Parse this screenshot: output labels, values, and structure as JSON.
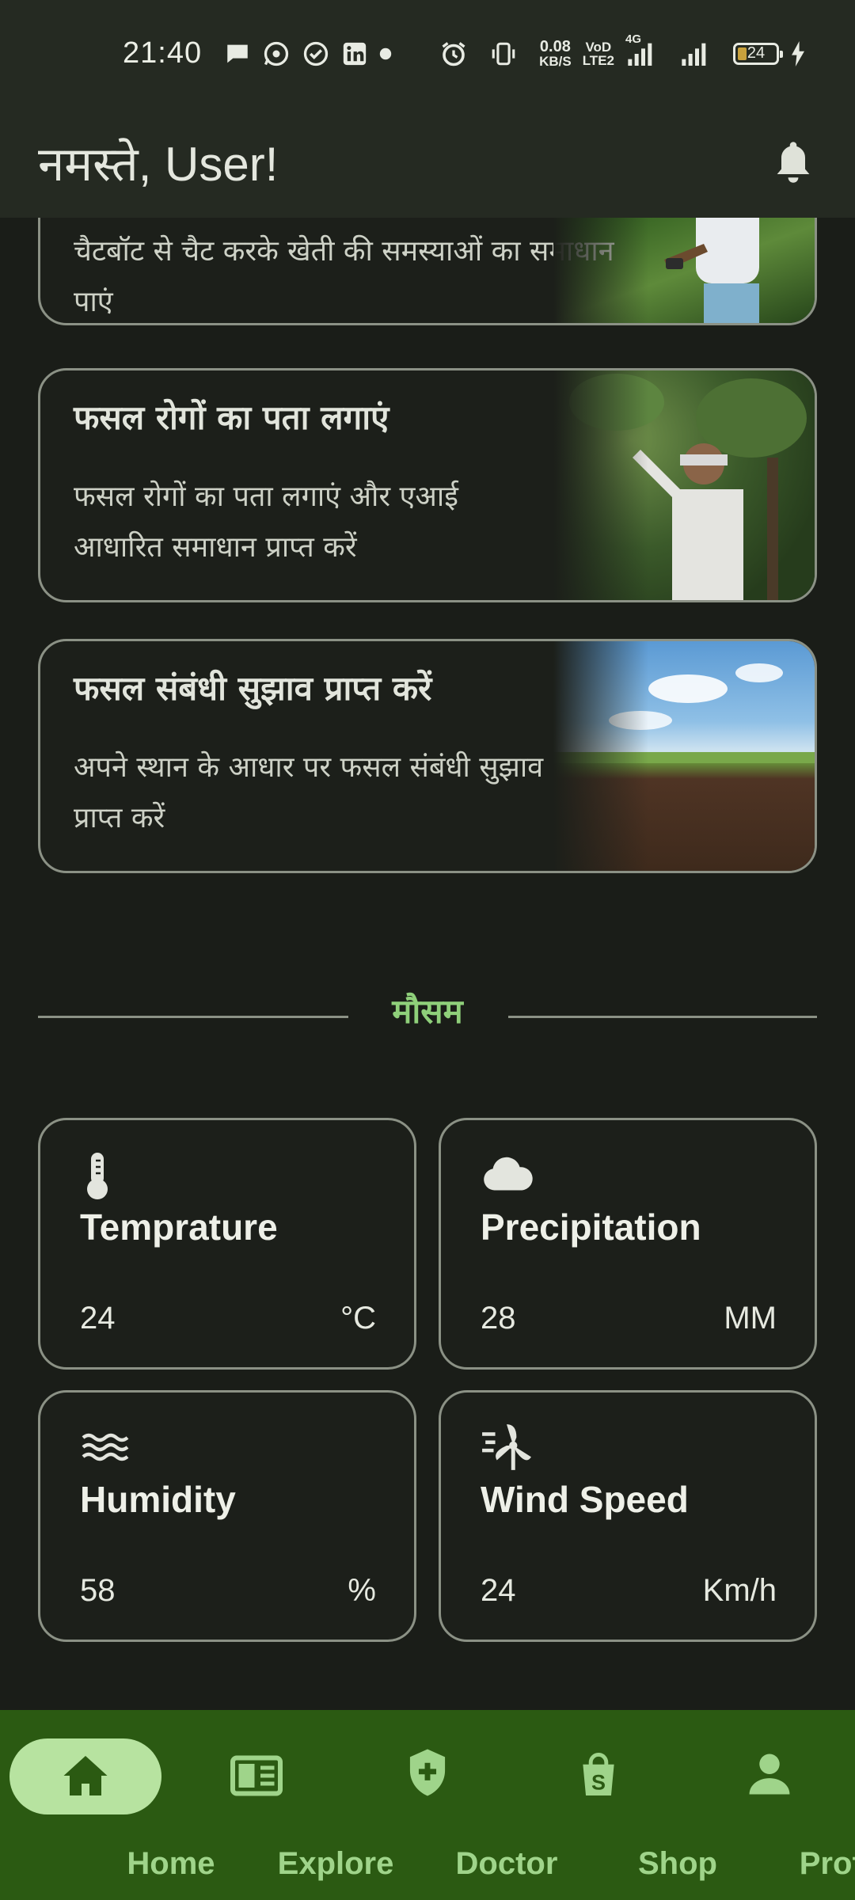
{
  "status_bar": {
    "time": "21:40",
    "net_speed_value": "0.08",
    "net_speed_unit": "KB/S",
    "network_label_top": "VoD",
    "network_label_bottom": "LTE2",
    "network_type": "4G",
    "battery_level": "24"
  },
  "header": {
    "greeting": "नमस्ते, User!"
  },
  "feature_cards": [
    {
      "title": "",
      "description": "चैटबॉट से चैट करके खेती की समस्याओं का समाधान पाएं"
    },
    {
      "title": "फसल रोगों का पता लगाएं",
      "description": "फसल रोगों का पता लगाएं और एआई आधारित समाधान प्राप्त करें"
    },
    {
      "title": "फसल संबंधी सुझाव प्राप्त करें",
      "description": "अपने स्थान के आधार पर फसल संबंधी सुझाव प्राप्त करें"
    }
  ],
  "weather": {
    "section_title": "मौसम",
    "cards": [
      {
        "title": "Temprature",
        "value": "24",
        "unit": "°C",
        "icon": "thermometer-icon"
      },
      {
        "title": "Precipitation",
        "value": "28",
        "unit": "MM",
        "icon": "cloud-icon"
      },
      {
        "title": "Humidity",
        "value": "58",
        "unit": "%",
        "icon": "humidity-waves-icon"
      },
      {
        "title": "Wind Speed",
        "value": "24",
        "unit": "Km/h",
        "icon": "wind-turbine-icon"
      }
    ]
  },
  "bottom_nav": {
    "active": "Home",
    "items": [
      {
        "label": "Home",
        "icon": "home-icon"
      },
      {
        "label": "Explore",
        "icon": "book-icon"
      },
      {
        "label": "Doctor",
        "icon": "shield-plus-icon"
      },
      {
        "label": "Shop",
        "icon": "shopping-bag-icon"
      },
      {
        "label": "Profile",
        "icon": "person-icon"
      }
    ]
  },
  "colors": {
    "background": "#1a1d18",
    "app_bar": "#252a22",
    "accent_green": "#8fd07a",
    "nav_background": "#2b5a12",
    "nav_active_pill": "#b7e3a0"
  }
}
